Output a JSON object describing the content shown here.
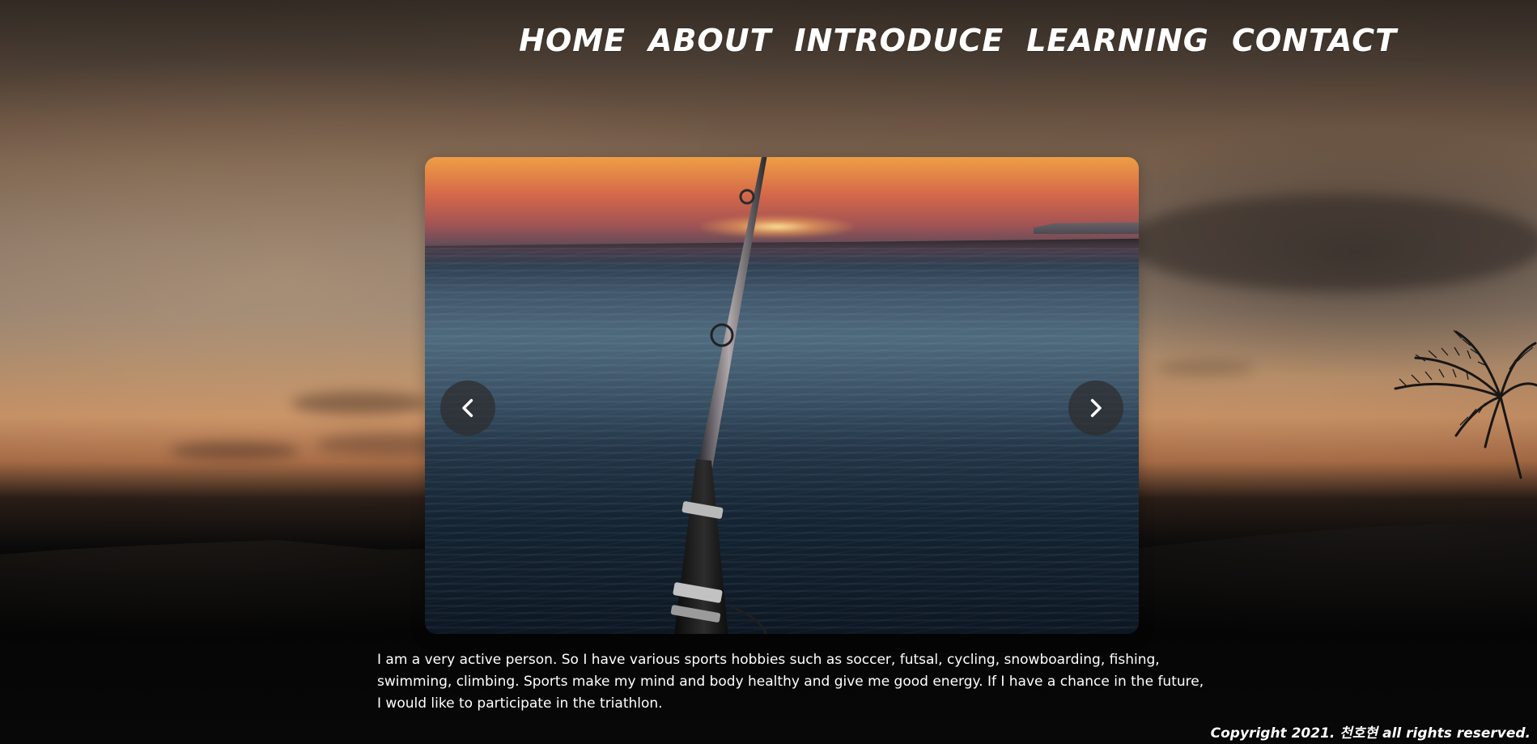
{
  "nav": {
    "items": [
      {
        "label": "HOME"
      },
      {
        "label": "ABOUT"
      },
      {
        "label": "INTRODUCE"
      },
      {
        "label": "LEARNING"
      },
      {
        "label": "CONTACT"
      }
    ]
  },
  "slider": {
    "left_icon": "chevron-left-icon",
    "right_icon": "chevron-right-icon"
  },
  "content": {
    "line1": "I am a very active person. So I have various sports hobbies such as soccer, futsal, cycling, snowboarding, fishing,",
    "line2": "swimming, climbing. Sports make my mind and body healthy and give me good energy. If I have a chance in the future,",
    "line3": "I would like to participate in the triathlon."
  },
  "footer": {
    "copyright": "Copyright 2021. 천호현 all rights reserved."
  },
  "colors": {
    "nav_text": "#ffffff",
    "body_text": "#ffffff",
    "arrow_bg": "#2d2d2d"
  }
}
